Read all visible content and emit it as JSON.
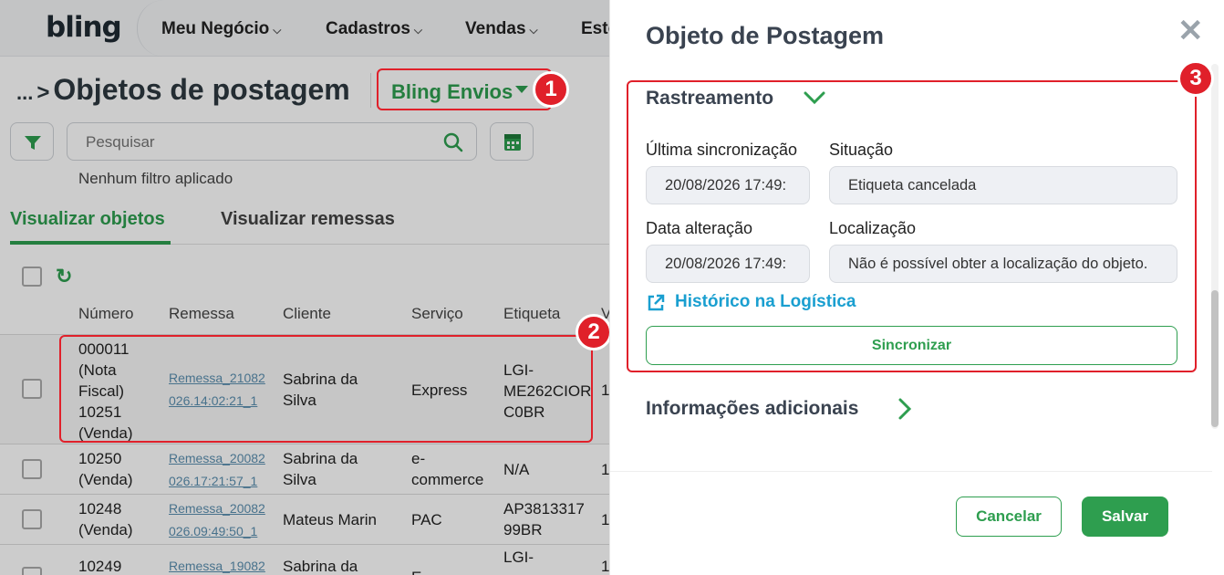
{
  "nav": {
    "logo": "bling",
    "items": [
      "Meu Negócio",
      "Cadastros",
      "Vendas",
      "Esto"
    ]
  },
  "page": {
    "crumb_dots": "...",
    "title": "Objetos de postagem",
    "integration": "Bling Envios",
    "search_placeholder": "Pesquisar",
    "no_filter": "Nenhum filtro aplicado",
    "tabs": [
      "Visualizar objetos",
      "Visualizar remessas"
    ]
  },
  "table": {
    "headers": [
      "Número",
      "Remessa",
      "Cliente",
      "Serviço",
      "Etiqueta",
      "V"
    ],
    "rows": [
      {
        "numero": [
          "000011",
          "(Nota",
          "Fiscal)",
          "10251",
          "(Venda)"
        ],
        "remessa": [
          "Remessa_21082",
          "026.14:02:21_1"
        ],
        "cliente": [
          "Sabrina da",
          "Silva"
        ],
        "servico": [
          "Express"
        ],
        "etiqueta": [
          "LGI-",
          "ME262CIOR",
          "C0BR"
        ],
        "v": "1"
      },
      {
        "numero": [
          "10250",
          "(Venda)"
        ],
        "remessa": [
          "Remessa_20082",
          "026.17:21:57_1"
        ],
        "cliente": [
          "Sabrina da",
          "Silva"
        ],
        "servico": [
          "e-",
          "commerce"
        ],
        "etiqueta": [
          "N/A"
        ],
        "v": "1"
      },
      {
        "numero": [
          "10248",
          "(Venda)"
        ],
        "remessa": [
          "Remessa_20082",
          "026.09:49:50_1"
        ],
        "cliente": [
          "Mateus Marin"
        ],
        "servico": [
          "PAC"
        ],
        "etiqueta": [
          "AP3813317",
          "99BR"
        ],
        "v": "1"
      },
      {
        "numero": [
          "10249"
        ],
        "remessa": [
          "Remessa_19082"
        ],
        "cliente": [
          "Sabrina da"
        ],
        "servico": [
          "E"
        ],
        "etiqueta": [
          "LGI-"
        ],
        "v": "1"
      }
    ]
  },
  "badges": [
    "1",
    "2",
    "3"
  ],
  "panel": {
    "title": "Objeto de Postagem",
    "tracking_title": "Rastreamento",
    "last_sync_label": "Última sincronização",
    "last_sync_value": "20/08/2026 17:49:",
    "status_label": "Situação",
    "status_value": "Etiqueta cancelada",
    "changed_label": "Data alteração",
    "changed_value": "20/08/2026 17:49:",
    "location_label": "Localização",
    "location_value": "Não é possível obter a localização do objeto.",
    "history_link": "Histórico na Logística",
    "sync_button": "Sincronizar",
    "additional_title": "Informações adicionais",
    "cancel_button": "Cancelar",
    "save_button": "Salvar"
  },
  "colors": {
    "accent": "#2e9e4f",
    "highlight": "#e0202a",
    "link": "#1a9fd0"
  }
}
